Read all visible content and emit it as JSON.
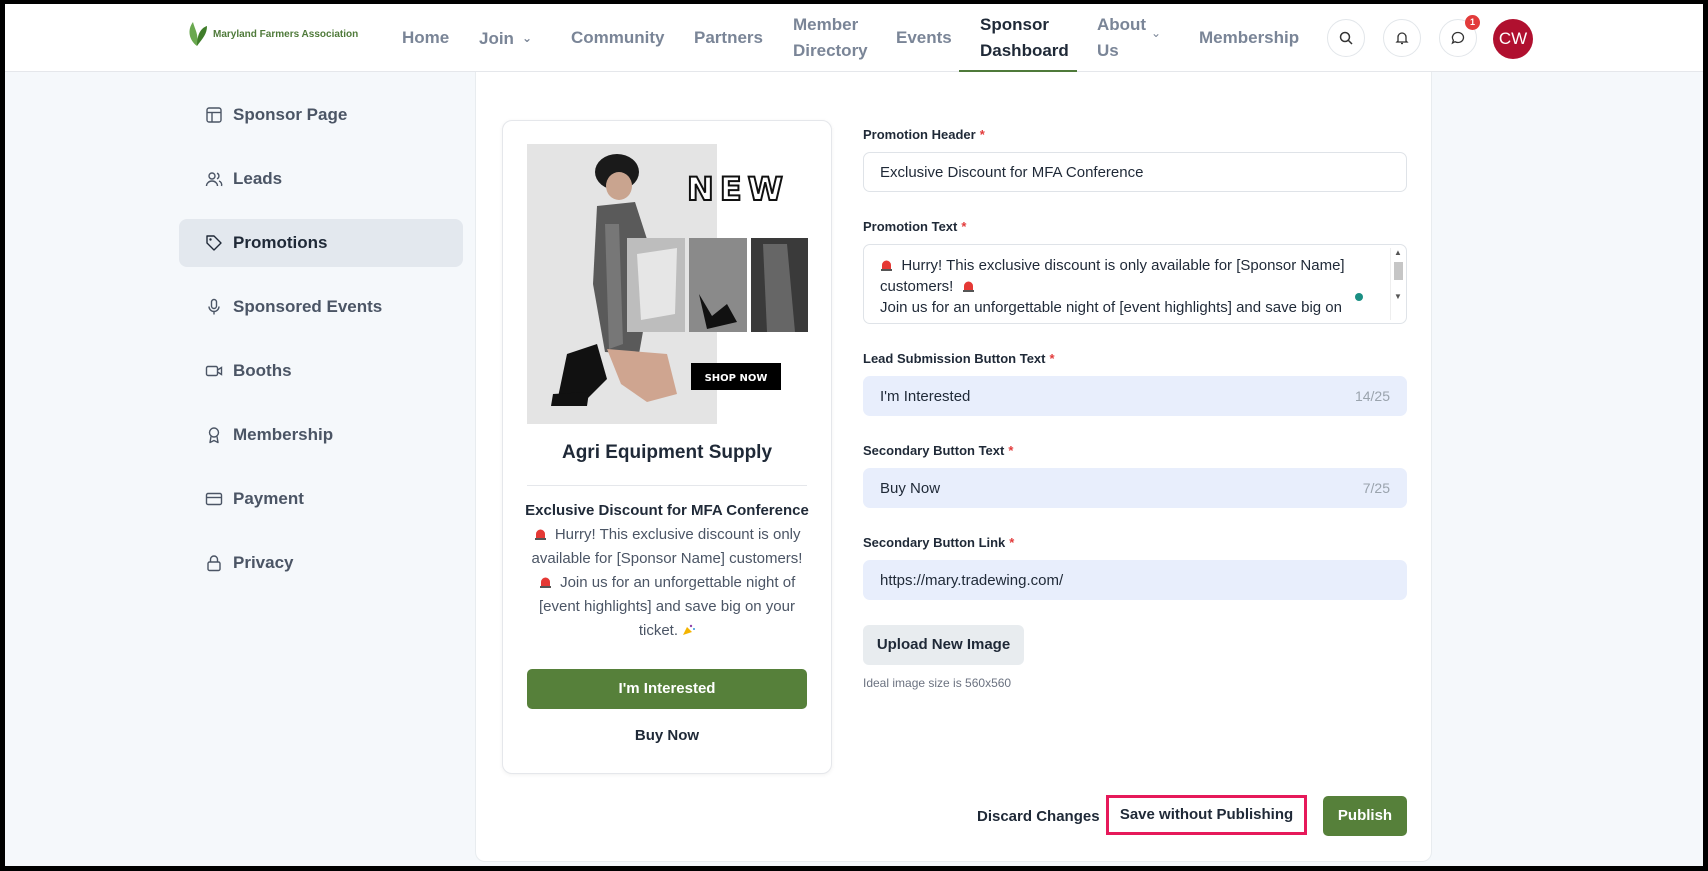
{
  "brand": {
    "name": "Maryland Farmers Association",
    "accent": "#56803a"
  },
  "nav": {
    "home": "Home",
    "join": "Join",
    "community": "Community",
    "partners": "Partners",
    "member_directory_1": "Member",
    "member_directory_2": "Directory",
    "events": "Events",
    "sponsor_dashboard_1": "Sponsor",
    "sponsor_dashboard_2": "Dashboard",
    "about_1": "About",
    "about_2": "Us",
    "membership": "Membership",
    "notification_count": "1",
    "avatar_initials": "CW"
  },
  "sidebar": {
    "items": [
      {
        "label": "Sponsor Page",
        "icon": "layout-icon"
      },
      {
        "label": "Leads",
        "icon": "users-icon"
      },
      {
        "label": "Promotions",
        "icon": "tag-icon",
        "active": true
      },
      {
        "label": "Sponsored Events",
        "icon": "microphone-icon"
      },
      {
        "label": "Booths",
        "icon": "video-icon"
      },
      {
        "label": "Membership",
        "icon": "award-icon"
      },
      {
        "label": "Payment",
        "icon": "credit-card-icon"
      },
      {
        "label": "Privacy",
        "icon": "lock-icon"
      }
    ]
  },
  "preview": {
    "image_text_new": "NEW",
    "image_text_shop": "SHOP NOW",
    "sponsor_name": "Agri Equipment Supply",
    "header": "Exclusive Discount for MFA Conference",
    "body_line_1": "Hurry! This exclusive discount is only",
    "body_line_2": "available for [Sponsor Name] customers!",
    "body_line_3": "Join us for an unforgettable night of",
    "body_line_4": "[event highlights] and save big on your",
    "body_line_5": "ticket.",
    "primary_button": "I'm Interested",
    "secondary_button": "Buy Now"
  },
  "form": {
    "promotion_header": {
      "label": "Promotion Header",
      "value": "Exclusive Discount for MFA Conference"
    },
    "promotion_text": {
      "label": "Promotion Text",
      "line_1": "Hurry! This exclusive discount is only available for [Sponsor Name]",
      "line_2": "customers!",
      "line_3": "Join us for an unforgettable night of [event highlights] and save big on"
    },
    "lead_button": {
      "label": "Lead Submission Button Text",
      "value": "I'm Interested",
      "counter": "14/25"
    },
    "secondary_button": {
      "label": "Secondary Button Text",
      "value": "Buy Now",
      "counter": "7/25"
    },
    "secondary_link": {
      "label": "Secondary Button Link",
      "value": "https://mary.tradewing.com/"
    },
    "upload_button": "Upload New Image",
    "upload_hint": "Ideal image size is 560x560",
    "required_mark": "*"
  },
  "actions": {
    "discard": "Discard Changes",
    "save": "Save without Publishing",
    "publish": "Publish"
  }
}
